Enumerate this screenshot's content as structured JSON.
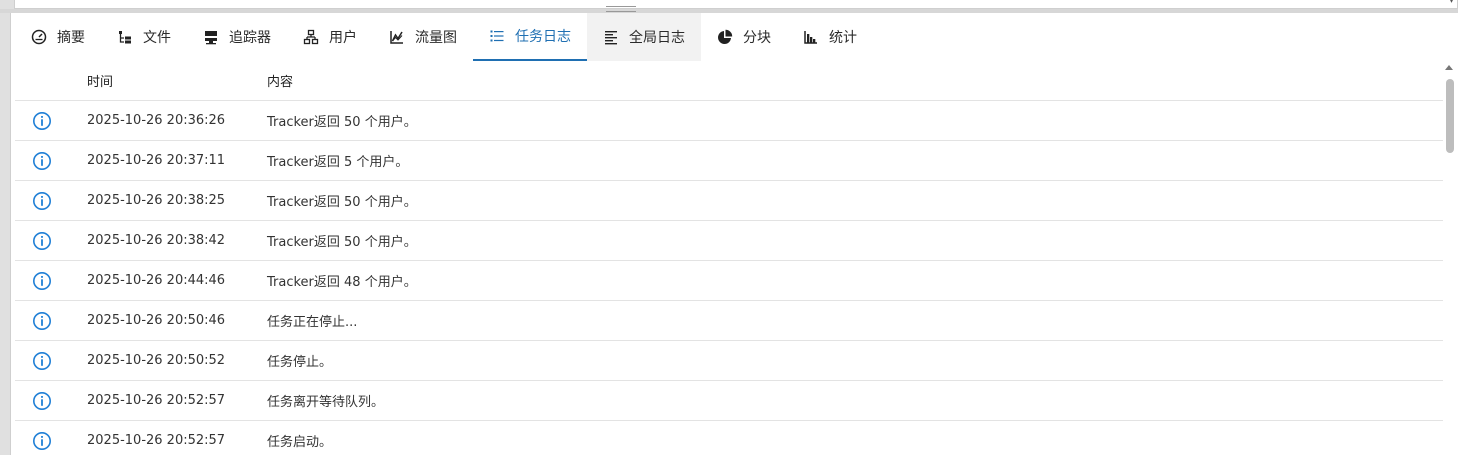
{
  "tabs": [
    {
      "label": "摘要",
      "icon": "dashboard-icon",
      "active": false
    },
    {
      "label": "文件",
      "icon": "file-tree-icon",
      "active": false
    },
    {
      "label": "追踪器",
      "icon": "server-icon",
      "active": false
    },
    {
      "label": "用户",
      "icon": "network-icon",
      "active": false
    },
    {
      "label": "流量图",
      "icon": "chart-line-icon",
      "active": false
    },
    {
      "label": "任务日志",
      "icon": "list-icon",
      "active": true
    },
    {
      "label": "全局日志",
      "icon": "text-lines-icon",
      "active": false,
      "hover": true
    },
    {
      "label": "分块",
      "icon": "pie-chart-icon",
      "active": false
    },
    {
      "label": "统计",
      "icon": "bar-chart-icon",
      "active": false
    }
  ],
  "log_table": {
    "headers": {
      "time": "时间",
      "content": "内容"
    },
    "rows": [
      {
        "level": "info",
        "time": "2025-10-26 20:36:26",
        "message": "Tracker返回 50 个用户。"
      },
      {
        "level": "info",
        "time": "2025-10-26 20:37:11",
        "message": "Tracker返回 5 个用户。"
      },
      {
        "level": "info",
        "time": "2025-10-26 20:38:25",
        "message": "Tracker返回 50 个用户。"
      },
      {
        "level": "info",
        "time": "2025-10-26 20:38:42",
        "message": "Tracker返回 50 个用户。"
      },
      {
        "level": "info",
        "time": "2025-10-26 20:44:46",
        "message": "Tracker返回 48 个用户。"
      },
      {
        "level": "info",
        "time": "2025-10-26 20:50:46",
        "message": "任务正在停止..."
      },
      {
        "level": "info",
        "time": "2025-10-26 20:50:52",
        "message": "任务停止。"
      },
      {
        "level": "info",
        "time": "2025-10-26 20:52:57",
        "message": "任务离开等待队列。"
      },
      {
        "level": "info",
        "time": "2025-10-26 20:52:57",
        "message": "任务启动。"
      }
    ]
  },
  "colors": {
    "accent": "#1f6fb2",
    "info": "#1f7fd6"
  }
}
